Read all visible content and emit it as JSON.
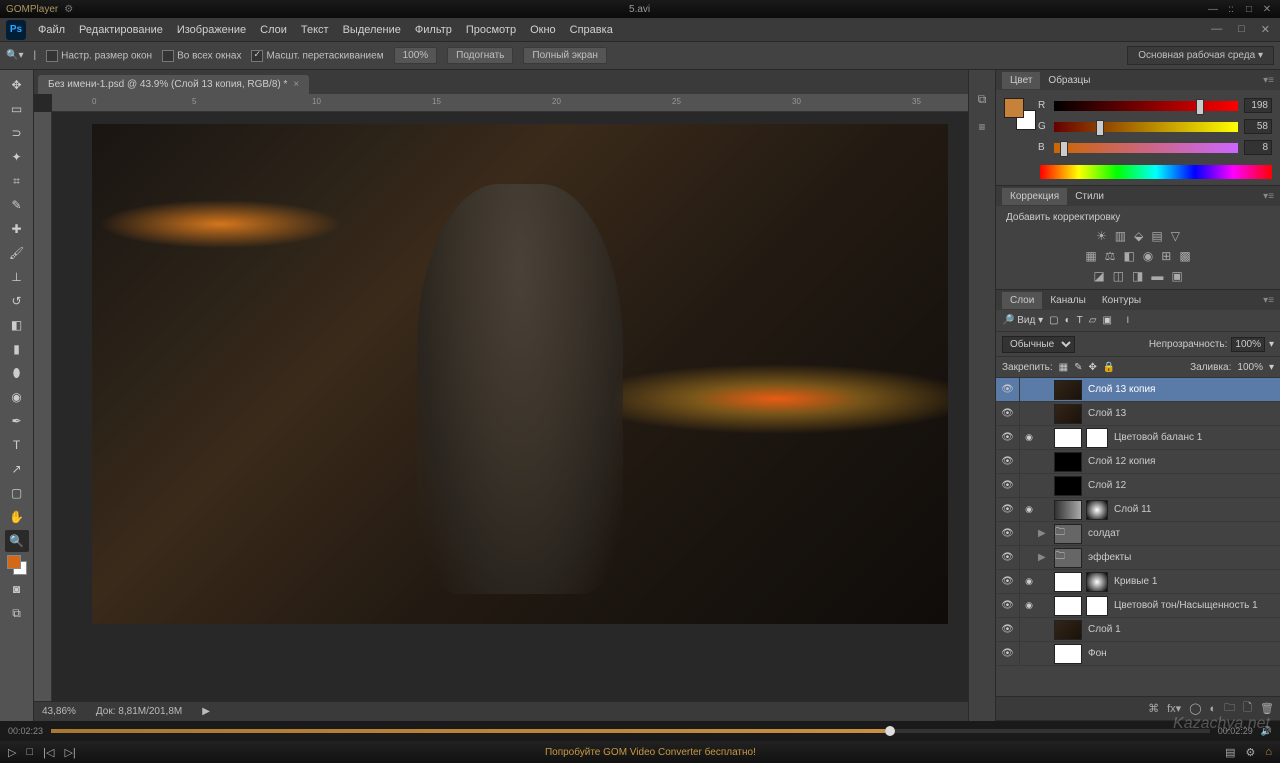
{
  "gom": {
    "app": "GOMPlayer",
    "file": "5.avi",
    "time_cur": "00:02:23",
    "time_total": "00:02:29",
    "promo": "Попробуйте GOM Video Converter бесплатно!"
  },
  "ps": {
    "menu": [
      "Файл",
      "Редактирование",
      "Изображение",
      "Слои",
      "Текст",
      "Выделение",
      "Фильтр",
      "Просмотр",
      "Окно",
      "Справка"
    ],
    "opts": {
      "resize": "Настр. размер окон",
      "allwin": "Во всех окнах",
      "scrub": "Масшт. перетаскиванием",
      "zoom": "100%",
      "fit": "Подогнать",
      "full": "Полный экран",
      "workspace": "Основная рабочая среда"
    },
    "tab": "Без имени-1.psd @ 43.9% (Слой 13 копия, RGB/8) *",
    "status": {
      "zoom": "43,86%",
      "doc": "Док: 8,81M/201,8M"
    },
    "color": {
      "tab1": "Цвет",
      "tab2": "Образцы",
      "r": "R",
      "g": "G",
      "b": "B",
      "rv": "198",
      "gv": "58",
      "bv": "8"
    },
    "adj": {
      "tab1": "Коррекция",
      "tab2": "Стили",
      "add": "Добавить корректировку"
    },
    "layers": {
      "tab1": "Слои",
      "tab2": "Каналы",
      "tab3": "Контуры",
      "filter": "Вид",
      "blend": "Обычные",
      "opacity_l": "Непрозрачность:",
      "opacity_v": "100%",
      "lock": "Закрепить:",
      "fill_l": "Заливка:",
      "fill_v": "100%",
      "items": [
        {
          "name": "Слой 13 копия",
          "sel": true,
          "thumb": "img"
        },
        {
          "name": "Слой 13",
          "thumb": "img"
        },
        {
          "name": "Цветовой баланс 1",
          "fx": true,
          "mask": true,
          "thumb": "wht"
        },
        {
          "name": "Слой 12 копия",
          "thumb": "blk"
        },
        {
          "name": "Слой 12",
          "thumb": "blk"
        },
        {
          "name": "Слой 11",
          "fx": true,
          "mask": "gr",
          "thumb": "gry"
        },
        {
          "name": "солдат",
          "folder": true
        },
        {
          "name": "эффекты",
          "folder": true
        },
        {
          "name": "Кривые 1",
          "fx": true,
          "mask": "gr",
          "thumb": "wht"
        },
        {
          "name": "Цветовой тон/Насыщенность 1",
          "fx": true,
          "mask": true,
          "thumb": "wht"
        },
        {
          "name": "Слой 1",
          "thumb": "img"
        },
        {
          "name": "Фон",
          "thumb": "wht"
        }
      ]
    }
  },
  "watermark": "Kazachya.net"
}
